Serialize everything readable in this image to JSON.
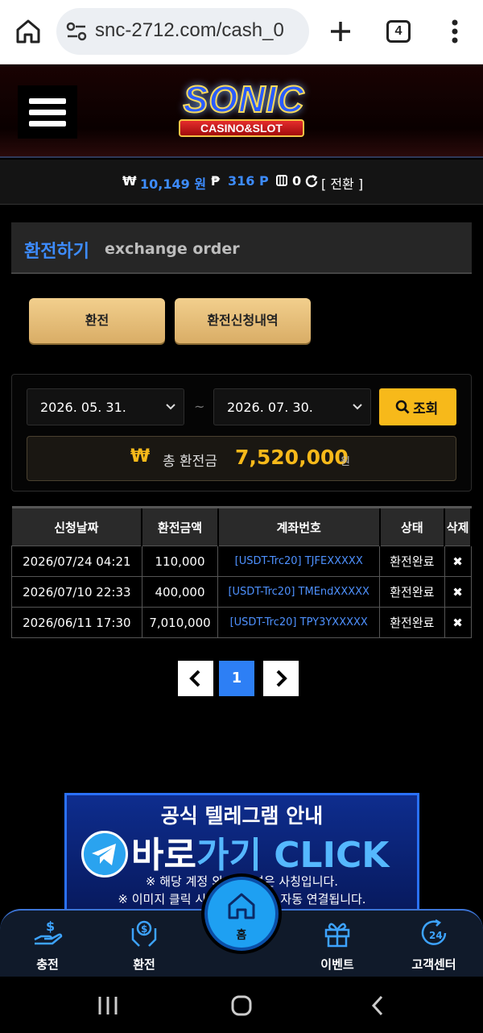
{
  "browser": {
    "url": "snc-2712.com/cash_0",
    "tab_count": "4"
  },
  "site": {
    "logo_title": "SONIC",
    "logo_subtitle": "CASINO&SLOT"
  },
  "balance": {
    "won_symbol": "₩",
    "cash": "10,149 원",
    "point_symbol": "₱",
    "points": "316 P",
    "chip_count": "0",
    "convert_label": "[ 전환 ]"
  },
  "page": {
    "title_ko": "환전하기",
    "title_en": "exchange order"
  },
  "tabs": {
    "exchange": "환전",
    "history": "환전신청내역"
  },
  "search": {
    "start_date": "2026. 05. 31.",
    "end_date": "2026. 07. 30.",
    "separator": "~",
    "button_label": "조회"
  },
  "total": {
    "symbol": "₩",
    "label": "총 환전금",
    "amount": "7,520,000",
    "unit": "원"
  },
  "table": {
    "headers": [
      "신청날짜",
      "환전금액",
      "계좌번호",
      "상태",
      "삭제"
    ],
    "rows": [
      {
        "date": "2026/07/24 04:21",
        "amount": "110,000",
        "account": "[USDT-Trc20] TJFEXXXXX",
        "status": "환전완료",
        "delete": "✖"
      },
      {
        "date": "2026/07/10 22:33",
        "amount": "400,000",
        "account": "[USDT-Trc20] TMEndXXXXX",
        "status": "환전완료",
        "delete": "✖"
      },
      {
        "date": "2026/06/11 17:30",
        "amount": "7,010,000",
        "account": "[USDT-Trc20] TPY3YXXXXX",
        "status": "환전완료",
        "delete": "✖"
      }
    ]
  },
  "pagination": {
    "prev": "‹",
    "current": "1",
    "next": "›"
  },
  "banner": {
    "line1": "공식 텔레그램 안내",
    "line2a": "바로",
    "line2b": "가기 CLICK",
    "line3": "※ 해당 계정 외 봇,채널은 사칭입니다.",
    "line4": "※ 이미지 클릭 시 텔레그램으로 자동 연결됩니다."
  },
  "bottom_nav": {
    "deposit": "충전",
    "withdraw": "환전",
    "home": "홈",
    "event": "이벤트",
    "support": "고객센터"
  },
  "colors": {
    "accent_blue": "#3d8cff",
    "gold": "#f7b91a",
    "button_gold": "#e5bd7a",
    "nav_blue": "#1ea0f2"
  }
}
